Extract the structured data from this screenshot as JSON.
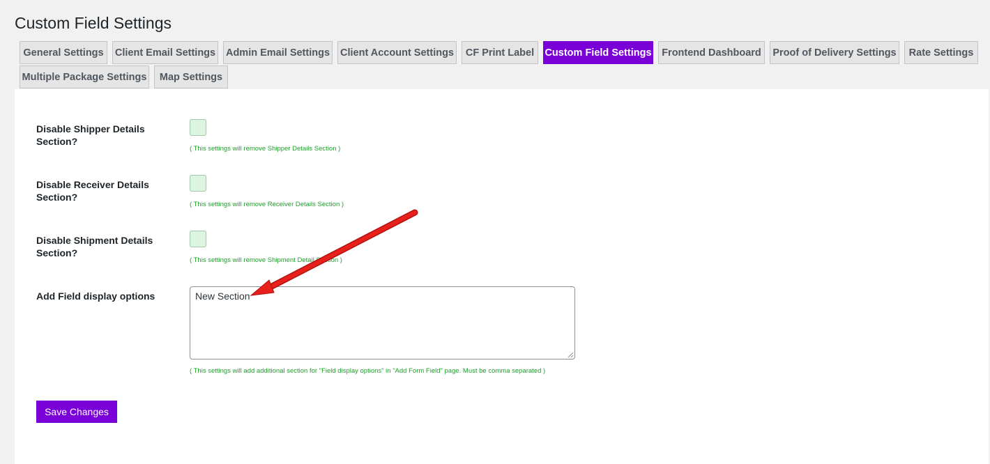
{
  "page": {
    "title": "Custom Field Settings"
  },
  "tabs": [
    {
      "label": "General Settings",
      "active": false
    },
    {
      "label": "Client Email Settings",
      "active": false
    },
    {
      "label": "Admin Email Settings",
      "active": false
    },
    {
      "label": "Client Account Settings",
      "active": false
    },
    {
      "label": "CF Print Label",
      "active": false
    },
    {
      "label": "Custom Field Settings",
      "active": true
    },
    {
      "label": "Frontend Dashboard",
      "active": false
    },
    {
      "label": "Proof of Delivery Settings",
      "active": false
    },
    {
      "label": "Rate Settings",
      "active": false
    },
    {
      "label": "Multiple Package Settings",
      "active": false
    },
    {
      "label": "Map Settings",
      "active": false
    }
  ],
  "settings": [
    {
      "label": "Disable Shipper Details Section?",
      "checked": false,
      "help": "( This settings will remove Shipper Details Section )"
    },
    {
      "label": "Disable Receiver Details Section?",
      "checked": false,
      "help": "( This settings will remove Receiver Details Section )"
    },
    {
      "label": "Disable Shipment Details Section?",
      "checked": false,
      "help": "( This settings will remove Shipment Detail Section )"
    }
  ],
  "field_display": {
    "label": "Add Field display options",
    "value": "New Section",
    "help": "( This settings will add additional section for \"Field display options\" in \"Add Form Field\" page. Must be comma separated )"
  },
  "save_button": {
    "label": "Save Changes"
  },
  "colors": {
    "accent": "#7a00d8",
    "help_text": "#1e9e2c",
    "checkbox_bg": "#dcf5e0",
    "annotation_arrow": "#e8201c"
  }
}
